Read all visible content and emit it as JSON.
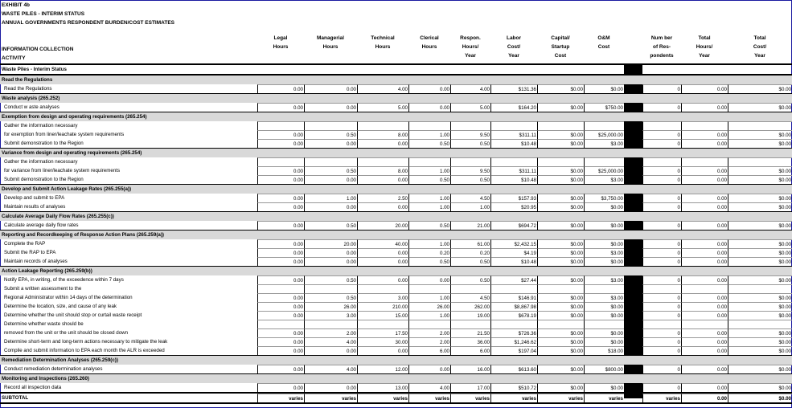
{
  "titles": [
    "EXHIBIT 4b",
    "WASTE PILES - INTERIM STATUS",
    "ANNUAL GOVERNMENTS RESPONDENT BURDEN/COST ESTIMATES"
  ],
  "header": {
    "activity": "INFORMATION COLLECTION\nACTIVITY",
    "cols": [
      "Legal\nHours",
      "Managerial\nHours",
      "Technical\nHours",
      "Clerical\nHours",
      "Respon.\nHours/\nYear",
      "Labor\nCost/\nYear",
      "Capital/\nStartup\nCost",
      "O&M\nCost",
      "Num ber\nof Res-\npondents",
      "Total\nHours/\nYear",
      "Total\nCost/\nYear"
    ]
  },
  "band_title": "Waste Piles - Interim Status",
  "rows": [
    {
      "t": "sec",
      "label": "Read the Regulations"
    },
    {
      "t": "d",
      "label": "Read the Regulations",
      "v": [
        "0.00",
        "0.00",
        "4.00",
        "0.00",
        "4.00",
        "$131.36",
        "$0.00",
        "$0.00",
        "0",
        "0.00",
        "$0.00"
      ]
    },
    {
      "t": "sec",
      "label": "Waste analysis (265.252)"
    },
    {
      "t": "d",
      "label": "Conduct w aste analyses",
      "v": [
        "0.00",
        "0.00",
        "5.00",
        "0.00",
        "5.00",
        "$164.20",
        "$0.00",
        "$750.00",
        "0",
        "0.00",
        "$0.00"
      ]
    },
    {
      "t": "sec",
      "label": "Exemption from design and operating requirements (265.254)"
    },
    {
      "t": "d",
      "label": "Gather the information necessary",
      "v": [
        "",
        "",
        "",
        "",
        "",
        "",
        "",
        "",
        "",
        "",
        ""
      ]
    },
    {
      "t": "d",
      "label": "for exemption from liner/leachate system requirements",
      "v": [
        "0.00",
        "0.50",
        "8.00",
        "1.00",
        "9.50",
        "$311.11",
        "$0.00",
        "$25,000.00",
        "0",
        "0.00",
        "$0.00"
      ]
    },
    {
      "t": "d",
      "label": "Submit demonstration to the Region",
      "v": [
        "0.00",
        "0.00",
        "0.00",
        "0.50",
        "0.50",
        "$10.48",
        "$0.00",
        "$3.00",
        "0",
        "0.00",
        "$0.00"
      ]
    },
    {
      "t": "sec",
      "label": "Variance from design and operating requirements (265.254)"
    },
    {
      "t": "d",
      "label": "Gather the information necessary",
      "v": [
        "",
        "",
        "",
        "",
        "",
        "",
        "",
        "",
        "",
        "",
        ""
      ]
    },
    {
      "t": "d",
      "label": "for variance from liner/leachate system requirements",
      "v": [
        "0.00",
        "0.50",
        "8.00",
        "1.00",
        "9.50",
        "$311.11",
        "$0.00",
        "$25,000.00",
        "0",
        "0.00",
        "$0.00"
      ]
    },
    {
      "t": "d",
      "label": "Submit demonstration to the Region",
      "v": [
        "0.00",
        "0.00",
        "0.00",
        "0.50",
        "0.50",
        "$10.48",
        "$0.00",
        "$3.00",
        "0",
        "0.00",
        "$0.00"
      ]
    },
    {
      "t": "sec",
      "label": "Develop and Submit Action Leakage Rates (265.255(a))"
    },
    {
      "t": "d",
      "label": "Develop and submit to EPA",
      "v": [
        "0.00",
        "1.00",
        "2.50",
        "1.00",
        "4.50",
        "$157.93",
        "$0.00",
        "$3,750.00",
        "0",
        "0.00",
        "$0.00"
      ]
    },
    {
      "t": "d",
      "label": "Maintain results of analyses",
      "v": [
        "0.00",
        "0.00",
        "0.00",
        "1.00",
        "1.00",
        "$20.95",
        "$0.00",
        "$0.00",
        "0",
        "0.00",
        "$0.00"
      ]
    },
    {
      "t": "sec",
      "label": "Calculate Average Daily Flow Rates (265.255(c))"
    },
    {
      "t": "d",
      "label": "Calculate average daily flow rates",
      "v": [
        "0.00",
        "0.50",
        "20.00",
        "0.50",
        "21.00",
        "$694.72",
        "$0.00",
        "$0.00",
        "0",
        "0.00",
        "$0.00"
      ]
    },
    {
      "t": "sec",
      "label": "Reporting and Recordkeeping of Response Action Plans (265.259(a))"
    },
    {
      "t": "d",
      "label": "Complete the RAP",
      "v": [
        "0.00",
        "20.00",
        "40.00",
        "1.00",
        "61.00",
        "$2,432.15",
        "$0.00",
        "$0.00",
        "0",
        "0.00",
        "$0.00"
      ]
    },
    {
      "t": "d",
      "label": "Submit the RAP to EPA",
      "v": [
        "0.00",
        "0.00",
        "0.00",
        "0.20",
        "0.20",
        "$4.19",
        "$0.00",
        "$3.00",
        "0",
        "0.00",
        "$0.00"
      ]
    },
    {
      "t": "d",
      "label": "Maintain records of analyses",
      "v": [
        "0.00",
        "0.00",
        "0.00",
        "0.50",
        "0.50",
        "$10.48",
        "$0.00",
        "$0.00",
        "0",
        "0.00",
        "$0.00"
      ]
    },
    {
      "t": "sec",
      "label": "Action Leakage Reporting (265.259(b))"
    },
    {
      "t": "d",
      "label": "Notify EPA, in writing, of the exceedence within 7 days",
      "v": [
        "0.00",
        "0.50",
        "0.00",
        "0.00",
        "0.50",
        "$27.44",
        "$0.00",
        "$3.00",
        "0",
        "0.00",
        "$0.00"
      ]
    },
    {
      "t": "d",
      "label": "Submit a written assessment to the",
      "v": [
        "",
        "",
        "",
        "",
        "",
        "",
        "",
        "",
        "",
        "",
        ""
      ]
    },
    {
      "t": "d",
      "label": "Regional Administrator within 14 days of the determination",
      "v": [
        "0.00",
        "0.50",
        "3.00",
        "1.00",
        "4.50",
        "$146.91",
        "$0.00",
        "$3.00",
        "0",
        "0.00",
        "$0.00"
      ]
    },
    {
      "t": "d",
      "label": "Determine the location, size, and cause of any leak",
      "v": [
        "0.00",
        "26.00",
        "210.00",
        "26.00",
        "262.00",
        "$8,867.98",
        "$0.00",
        "$0.00",
        "0",
        "0.00",
        "$0.00"
      ]
    },
    {
      "t": "d",
      "label": "Determine whether the unit should stop or curtail waste receipt",
      "v": [
        "0.00",
        "3.00",
        "15.00",
        "1.00",
        "19.00",
        "$678.19",
        "$0.00",
        "$0.00",
        "0",
        "0.00",
        "$0.00"
      ]
    },
    {
      "t": "d",
      "label": "Determine whether waste should be",
      "v": [
        "",
        "",
        "",
        "",
        "",
        "",
        "",
        "",
        "",
        "",
        ""
      ]
    },
    {
      "t": "d",
      "label": "removed from the unit or the unit should be closed down",
      "v": [
        "0.00",
        "2.00",
        "17.50",
        "2.00",
        "21.50",
        "$726.36",
        "$0.00",
        "$0.00",
        "0",
        "0.00",
        "$0.00"
      ]
    },
    {
      "t": "d",
      "label": "Determine short-term and long-term actions necessary to mitigate the leak",
      "v": [
        "0.00",
        "4.00",
        "30.00",
        "2.00",
        "36.00",
        "$1,246.62",
        "$0.00",
        "$0.00",
        "0",
        "0.00",
        "$0.00"
      ]
    },
    {
      "t": "d",
      "label": "Compile and submit information to EPA each month the ALR is exceeded",
      "v": [
        "0.00",
        "0.00",
        "0.00",
        "6.00",
        "6.00",
        "$197.04",
        "$0.00",
        "$18.00",
        "0",
        "0.00",
        "$0.00"
      ]
    },
    {
      "t": "sec",
      "label": "Remediation Determination Analyses (265.259(c))"
    },
    {
      "t": "d",
      "label": "Conduct remediation determination analyses",
      "v": [
        "0.00",
        "4.00",
        "12.00",
        "0.00",
        "16.00",
        "$613.60",
        "$0.00",
        "$800.00",
        "0",
        "0.00",
        "$0.00"
      ]
    },
    {
      "t": "sec",
      "label": "Monitoring and Inspections (265.260)"
    },
    {
      "t": "d",
      "label": "Record all inspection data",
      "v": [
        "0.00",
        "0.00",
        "13.00",
        "4.00",
        "17.00",
        "$510.72",
        "$0.00",
        "$0.00",
        "0",
        "0.00",
        "$0.00"
      ]
    },
    {
      "t": "sub",
      "label": "SUBTOTAL",
      "v": [
        "varies",
        "varies",
        "varies",
        "varies",
        "varies",
        "varies",
        "varies",
        "varies",
        "varies",
        "0.00",
        "$0.00"
      ]
    }
  ]
}
